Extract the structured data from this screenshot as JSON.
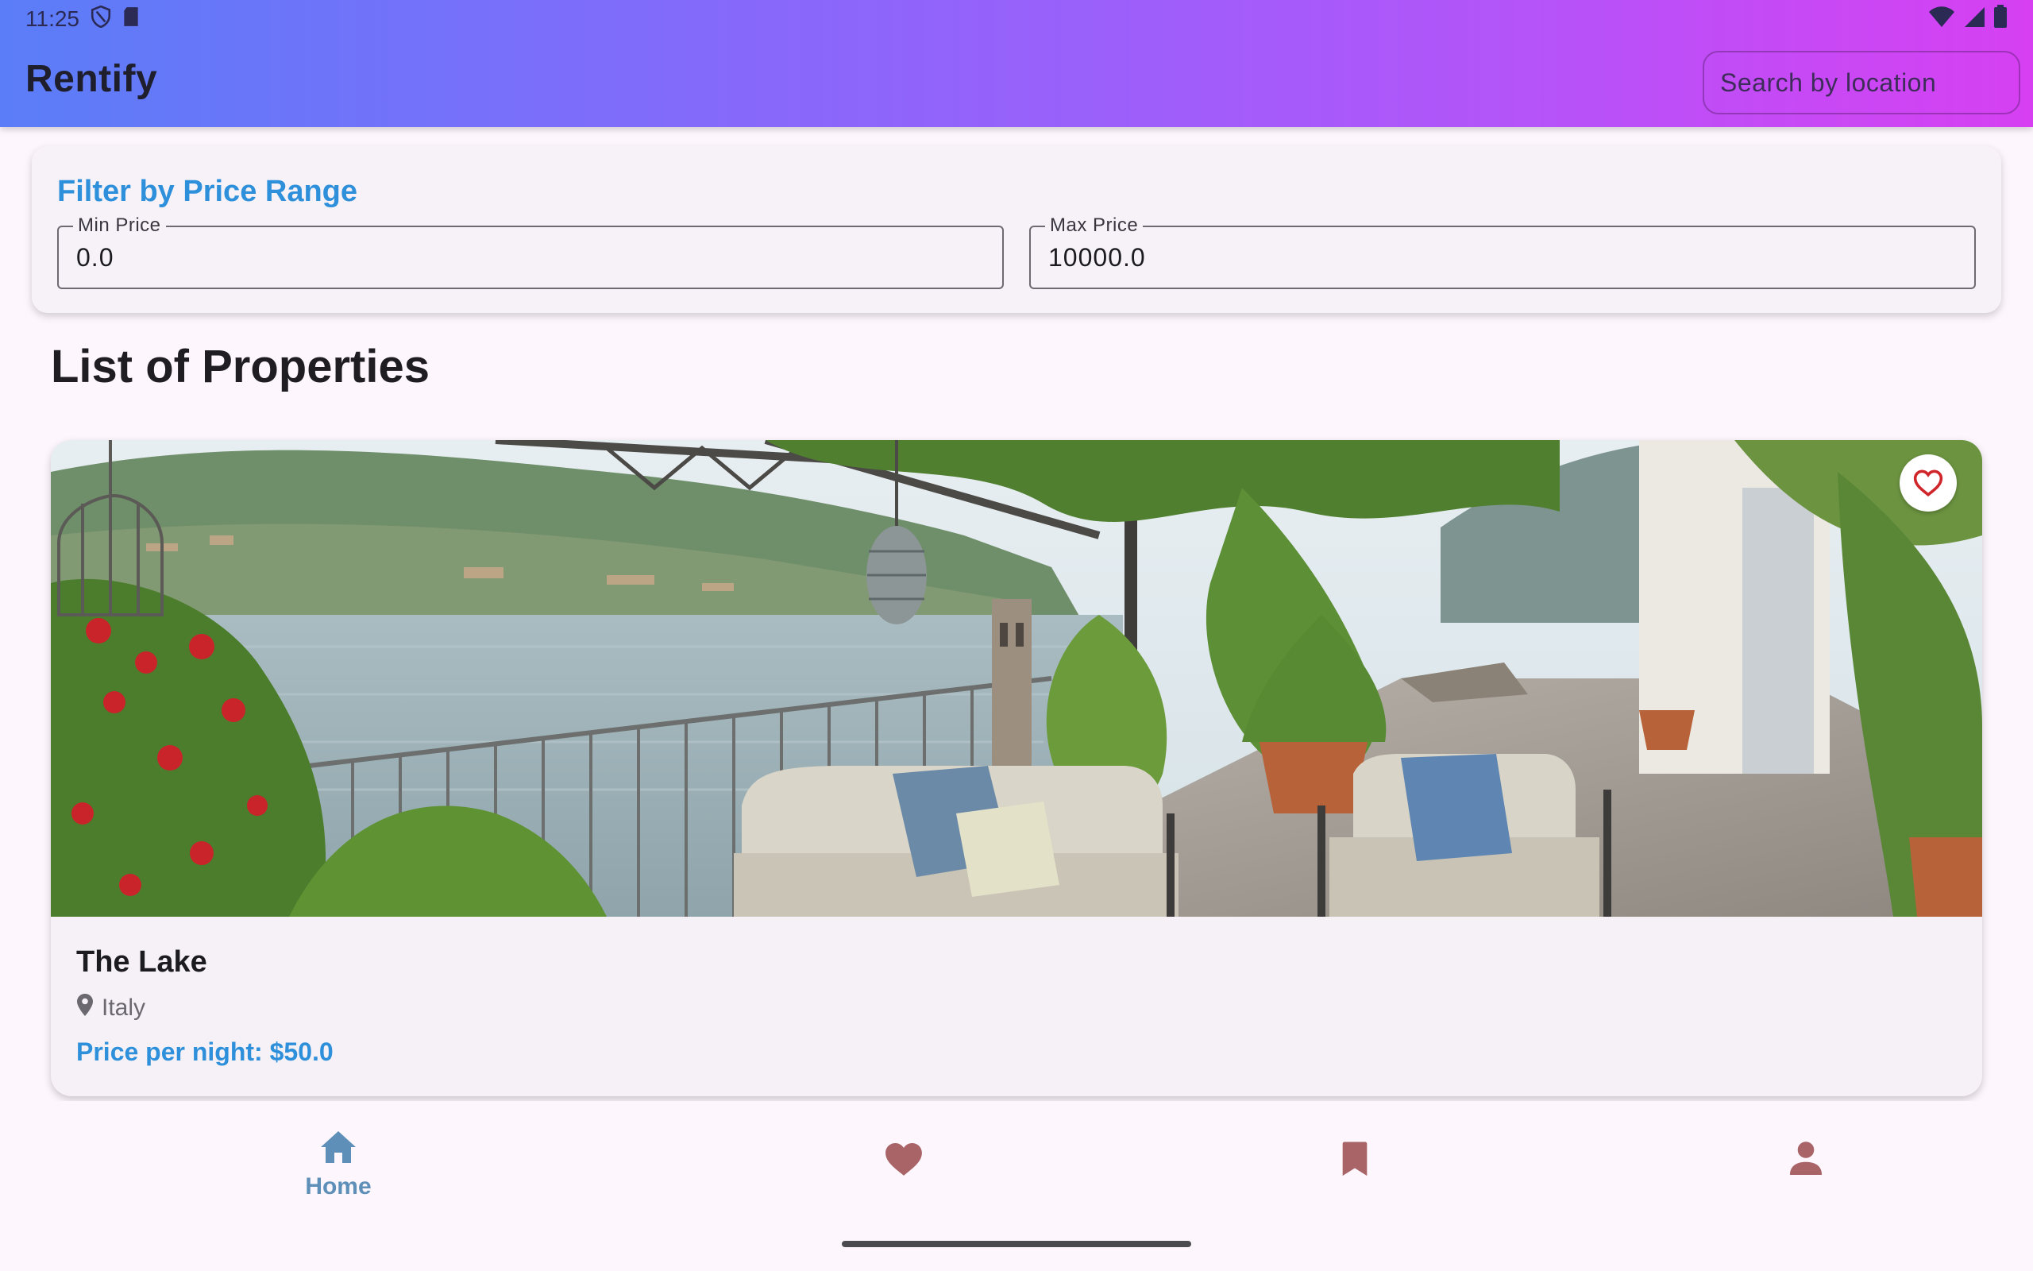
{
  "status_bar": {
    "time": "11:25"
  },
  "app_bar": {
    "title": "Rentify",
    "search_placeholder": "Search by location"
  },
  "filter": {
    "title": "Filter by Price Range",
    "min": {
      "label": "Min Price",
      "value": "0.0"
    },
    "max": {
      "label": "Max Price",
      "value": "10000.0"
    }
  },
  "section_title": "List of Properties",
  "properties": [
    {
      "name": "The Lake",
      "location": "Italy",
      "price_text": "Price per night: $50.0",
      "favorite_icon": "heart-outline-icon"
    }
  ],
  "bottom_nav": {
    "items": [
      {
        "label": "Home",
        "icon": "home-icon",
        "active": true
      },
      {
        "label": "",
        "icon": "heart-icon",
        "active": false
      },
      {
        "label": "",
        "icon": "bookmark-icon",
        "active": false
      },
      {
        "label": "",
        "icon": "person-icon",
        "active": false
      }
    ]
  },
  "colors": {
    "accent": "#2e90db",
    "nav_active": "#5d8fb8",
    "nav_inactive": "#a96468",
    "gradient_start": "#5b7df8",
    "gradient_end": "#d640f2"
  }
}
